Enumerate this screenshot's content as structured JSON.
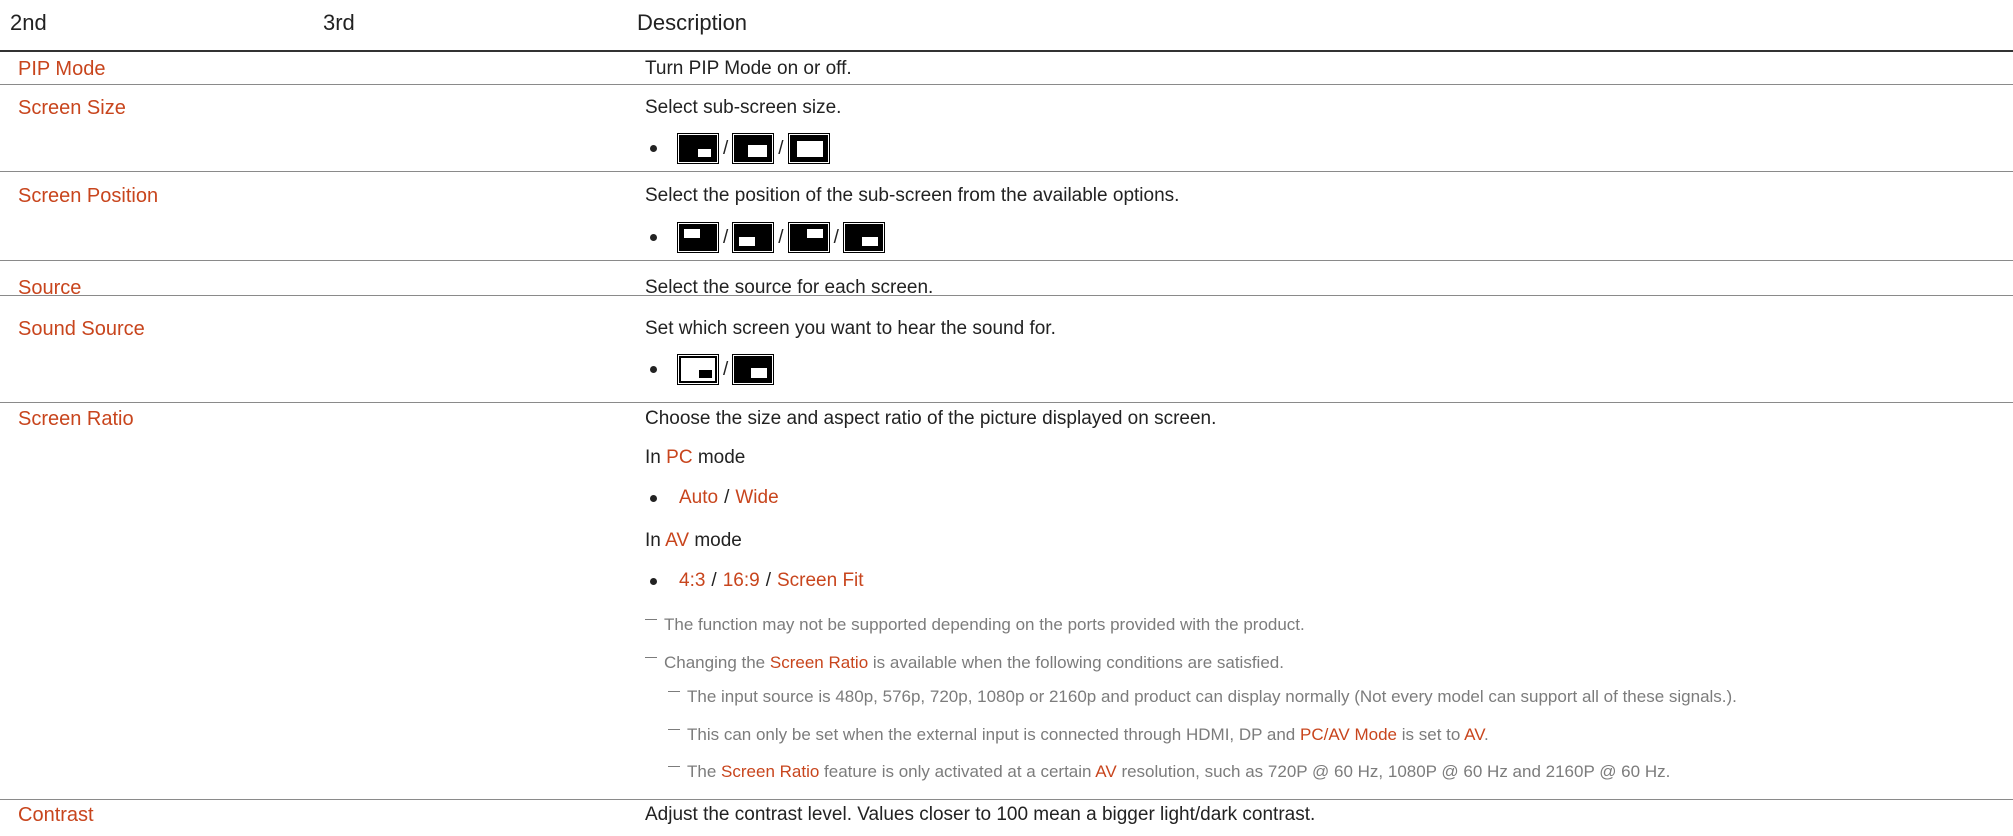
{
  "header": {
    "col2": "2nd",
    "col3": "3rd",
    "col_desc": "Description"
  },
  "rows": {
    "pip_mode": {
      "label": "PIP Mode",
      "desc": "Turn PIP Mode on or off."
    },
    "screen_size": {
      "label": "Screen Size",
      "desc": "Select sub-screen size.",
      "sep": "/",
      "icons": [
        "pip-size-small-icon",
        "pip-size-medium-icon",
        "pip-size-large-icon"
      ]
    },
    "screen_position": {
      "label": "Screen Position",
      "desc": "Select the position of the sub-screen from the available options.",
      "sep": "/",
      "icons": [
        "pip-position-top-left-icon",
        "pip-position-bottom-left-icon",
        "pip-position-top-right-icon",
        "pip-position-bottom-right-icon"
      ]
    },
    "source": {
      "label": "Source",
      "desc": "Select the source for each screen."
    },
    "sound_source": {
      "label": "Sound Source",
      "desc": "Set which screen you want to hear the sound for.",
      "sep": "/",
      "icons": [
        "main-screen-sound-icon",
        "sub-screen-sound-icon"
      ]
    },
    "screen_ratio": {
      "label": "Screen Ratio",
      "desc": "Choose the size and aspect ratio of the picture displayed on screen.",
      "pc_prefix": "In",
      "pc_word": "PC",
      "pc_suffix": "mode",
      "pc_opt1": "Auto",
      "pc_sep": "/",
      "pc_opt2": "Wide",
      "av_prefix": "In",
      "av_word": "AV",
      "av_suffix": "mode",
      "av_opt1": "4:3",
      "av_sep1": "/",
      "av_opt2": "16:9",
      "av_sep2": "/",
      "av_opt3": "Screen Fit",
      "note1": "The function may not be supported depending on the ports provided with the product.",
      "note2_a": "Changing the",
      "note2_b": "Screen Ratio",
      "note2_c": "is available when the following conditions are satisfied.",
      "note3": "The input source is 480p, 576p, 720p, 1080p or 2160p and product can display normally (Not every model can support all of these signals.).",
      "note4_a": "This can only be set when the external input is connected through HDMI, DP and",
      "note4_b": "PC/AV Mode",
      "note4_c": "is set to",
      "note4_d": "AV",
      "note4_e": ".",
      "note5_a": "The",
      "note5_b": "Screen Ratio",
      "note5_c": "feature is only activated at a certain",
      "note5_d": "AV",
      "note5_e": "resolution, such as 720P @ 60 Hz, 1080P @ 60 Hz and 2160P @ 60 Hz."
    },
    "contrast": {
      "label": "Contrast",
      "desc": "Adjust the contrast level. Values closer to 100 mean a bigger light/dark contrast."
    }
  },
  "colors": {
    "accent": "#c8451d",
    "note": "#7c7c7c",
    "rule": "#8a8a8a",
    "text": "#222222"
  }
}
